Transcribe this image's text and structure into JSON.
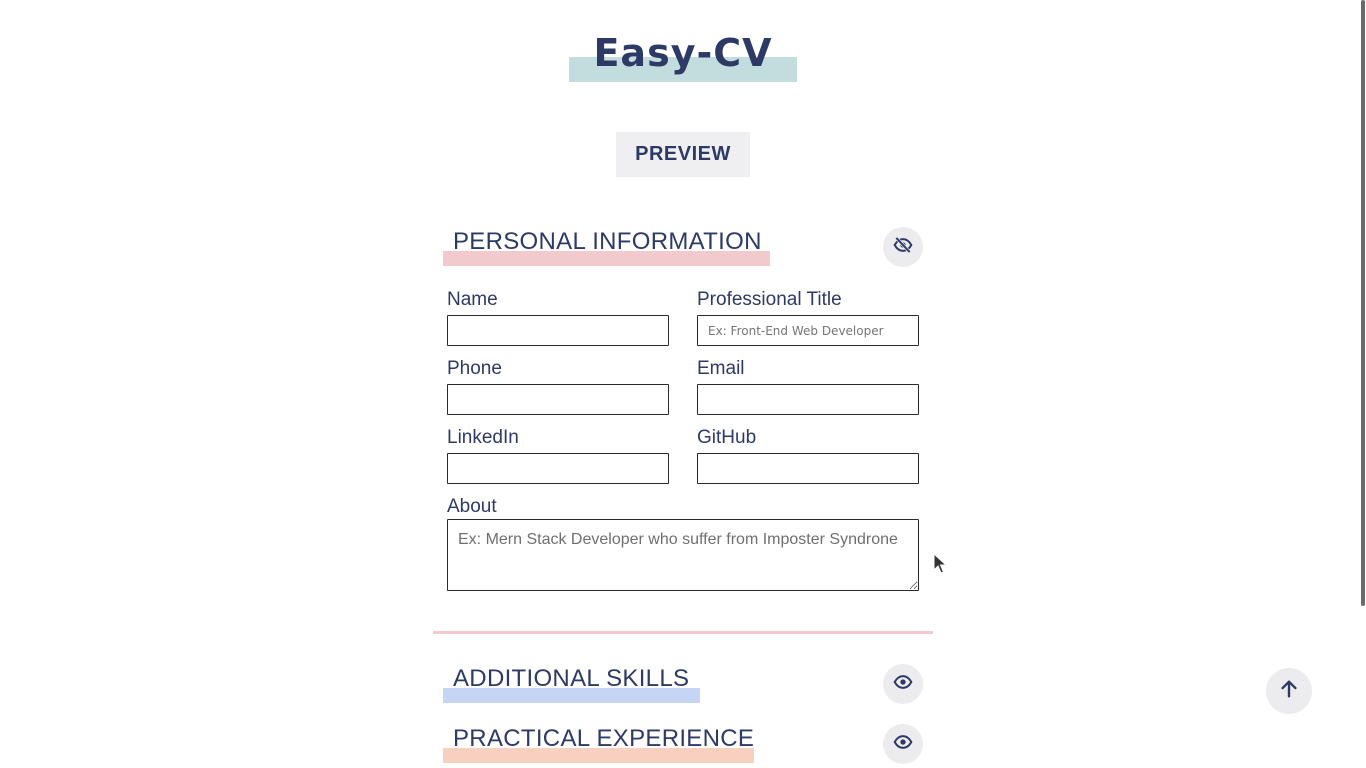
{
  "app": {
    "title": "Easy-CV",
    "preview_label": "PREVIEW"
  },
  "sections": {
    "personal": {
      "title": "PERSONAL INFORMATION",
      "highlight": "#f2c9cd",
      "toggle_icon": "eye-slash-icon"
    },
    "skills": {
      "title": "ADDITIONAL SKILLS",
      "highlight": "#c5d5f3",
      "toggle_icon": "eye-icon"
    },
    "experience": {
      "title": "PRACTICAL EXPERIENCE",
      "highlight": "#f8d0c0",
      "toggle_icon": "eye-icon"
    }
  },
  "form": {
    "name": {
      "label": "Name",
      "value": "",
      "placeholder": ""
    },
    "title": {
      "label": "Professional Title",
      "value": "",
      "placeholder": "Ex: Front-End Web Developer"
    },
    "phone": {
      "label": "Phone",
      "value": "",
      "placeholder": ""
    },
    "email": {
      "label": "Email",
      "value": "",
      "placeholder": ""
    },
    "linkedin": {
      "label": "LinkedIn",
      "value": "",
      "placeholder": ""
    },
    "github": {
      "label": "GitHub",
      "value": "",
      "placeholder": ""
    },
    "about": {
      "label": "About",
      "value": "",
      "placeholder": "Ex: Mern Stack Developer who suffer from Imposter Syndrone"
    }
  },
  "colors": {
    "text": "#2e3a66",
    "title_highlight": "#c3dcdd",
    "button_bg": "#efeff1"
  }
}
